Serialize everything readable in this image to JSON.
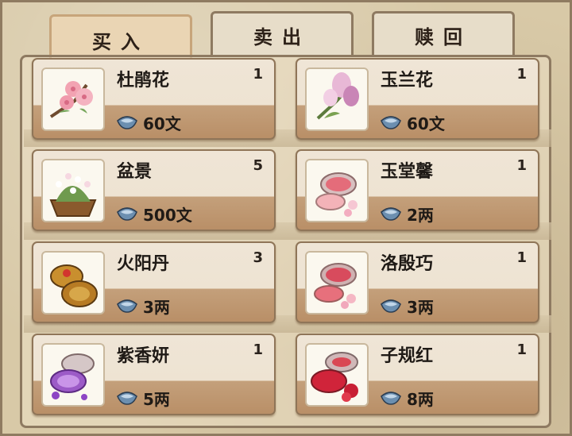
{
  "tabs": [
    {
      "label": "买入",
      "active": true
    },
    {
      "label": "卖出",
      "active": false
    },
    {
      "label": "赎回",
      "active": false
    }
  ],
  "items": [
    {
      "name": "杜鹃花",
      "qty": "1",
      "price": "60文",
      "icon": "azalea-flower-icon"
    },
    {
      "name": "玉兰花",
      "qty": "1",
      "price": "60文",
      "icon": "magnolia-flower-icon"
    },
    {
      "name": "盆景",
      "qty": "5",
      "price": "500文",
      "icon": "bonsai-pot-icon"
    },
    {
      "name": "玉堂馨",
      "qty": "1",
      "price": "2两",
      "icon": "rouge-compact-icon"
    },
    {
      "name": "火阳丹",
      "qty": "3",
      "price": "3两",
      "icon": "gold-box-icon"
    },
    {
      "name": "洛殷巧",
      "qty": "1",
      "price": "3两",
      "icon": "rouge-compact-icon"
    },
    {
      "name": "紫香妍",
      "qty": "1",
      "price": "5两",
      "icon": "purple-compact-icon"
    },
    {
      "name": "子规红",
      "qty": "1",
      "price": "8两",
      "icon": "red-compact-icon"
    }
  ],
  "colors": {
    "accent": "#c4a07b",
    "text": "#1f1a16"
  }
}
